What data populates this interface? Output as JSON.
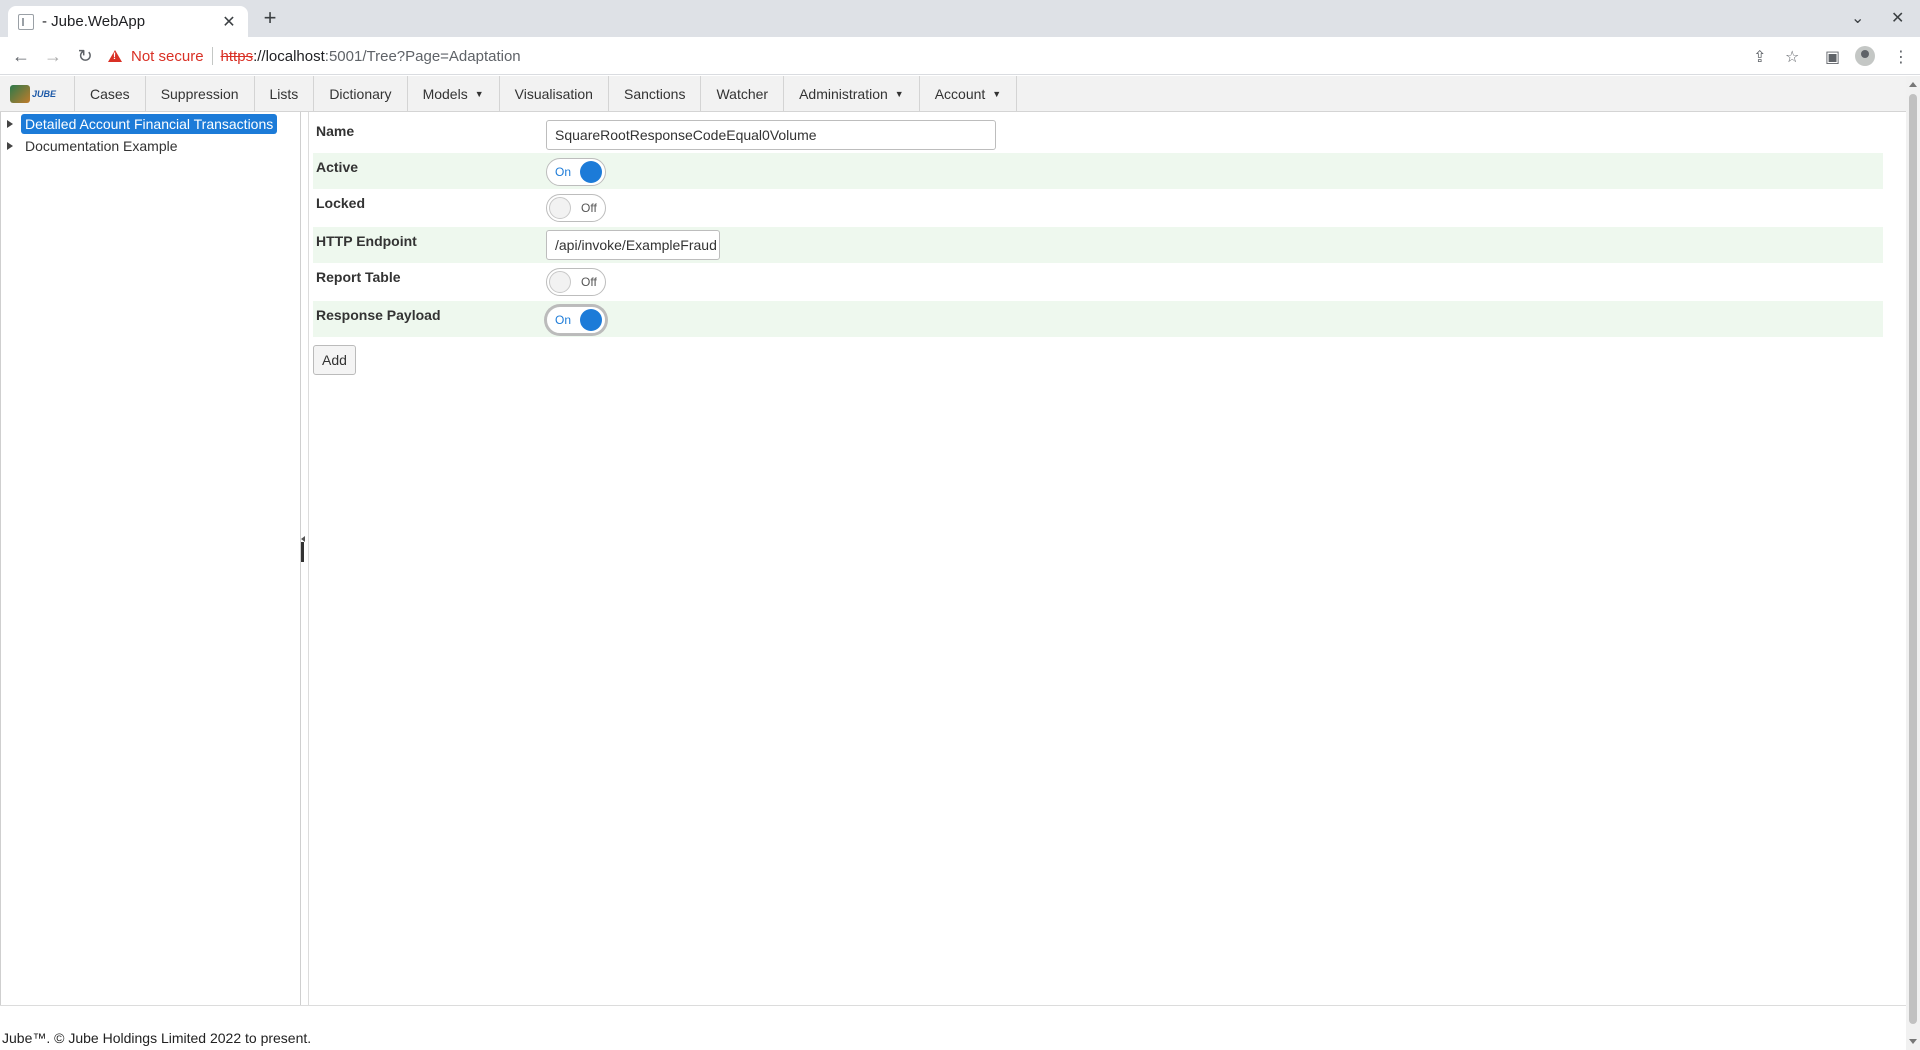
{
  "browser": {
    "tab_title": "- Jube.WebApp",
    "close_glyph": "✕",
    "newtab_glyph": "+",
    "security_label": "Not secure",
    "url_scheme": "https",
    "url_host": "://localhost",
    "url_path": ":5001/Tree?Page=Adaptation",
    "window_controls": [
      "⌄",
      "✕"
    ]
  },
  "app": {
    "logo_text": "JUBE",
    "nav": [
      {
        "label": "Cases",
        "dropdown": false
      },
      {
        "label": "Suppression",
        "dropdown": false
      },
      {
        "label": "Lists",
        "dropdown": false
      },
      {
        "label": "Dictionary",
        "dropdown": false
      },
      {
        "label": "Models",
        "dropdown": true
      },
      {
        "label": "Visualisation",
        "dropdown": false
      },
      {
        "label": "Sanctions",
        "dropdown": false
      },
      {
        "label": "Watcher",
        "dropdown": false
      },
      {
        "label": "Administration",
        "dropdown": true
      },
      {
        "label": "Account",
        "dropdown": true
      }
    ]
  },
  "tree": {
    "items": [
      {
        "label": "Detailed Account Financial Transactions",
        "selected": true
      },
      {
        "label": "Documentation Example",
        "selected": false
      }
    ]
  },
  "form": {
    "name": {
      "label": "Name",
      "value": "SquareRootResponseCodeEqual0Volume"
    },
    "active": {
      "label": "Active",
      "state": "On"
    },
    "locked": {
      "label": "Locked",
      "state": "Off"
    },
    "http_endpoint": {
      "label": "HTTP Endpoint",
      "value": "/api/invoke/ExampleFraud"
    },
    "report_table": {
      "label": "Report Table",
      "state": "Off"
    },
    "response_payload": {
      "label": "Response Payload",
      "state": "On"
    },
    "add_label": "Add"
  },
  "footer": {
    "text": "Jube™. © Jube Holdings Limited 2022 to present."
  },
  "colors": {
    "accent": "#1c7bd8",
    "row_highlight": "#eef8ee",
    "warning": "#d93025"
  }
}
